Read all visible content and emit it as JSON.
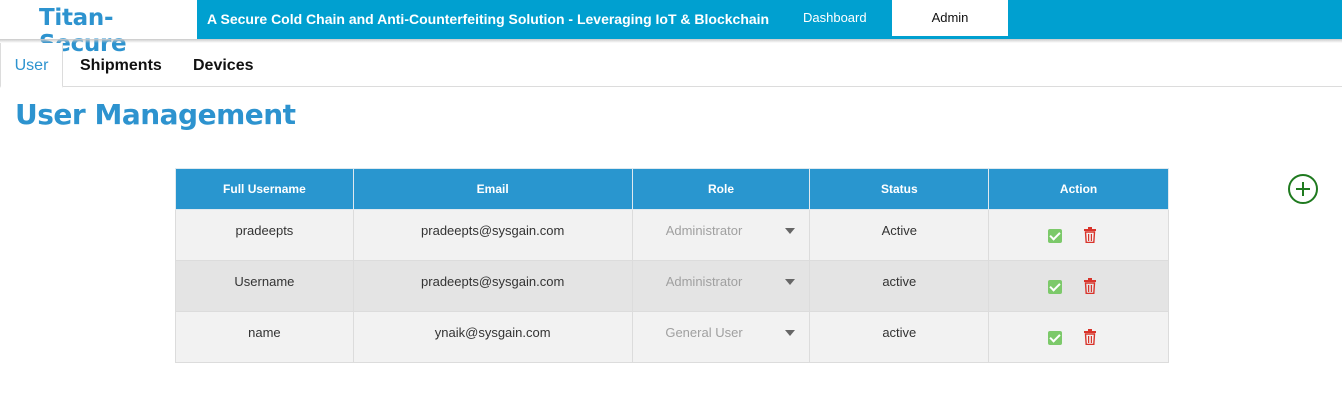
{
  "header": {
    "brand": "Titan-Secure",
    "tagline": "A Secure Cold Chain and Anti-Counterfeiting Solution - Leveraging IoT & Blockchain",
    "nav": {
      "dashboard": "Dashboard",
      "admin": "Admin"
    },
    "active_nav": "Admin"
  },
  "tabs": {
    "user": "User",
    "shipments": "Shipments",
    "devices": "Devices",
    "active": "User"
  },
  "page_title": "User Management",
  "table": {
    "headers": {
      "username": "Full Username",
      "email": "Email",
      "role": "Role",
      "status": "Status",
      "action": "Action"
    },
    "rows": [
      {
        "username": "pradeepts",
        "email": "pradeepts@sysgain.com",
        "role": "Administrator",
        "status": "Active"
      },
      {
        "username": "Username",
        "email": "pradeepts@sysgain.com",
        "role": "Administrator",
        "status": "active"
      },
      {
        "username": "name",
        "email": "ynaik@sysgain.com",
        "role": "General User",
        "status": "active"
      }
    ]
  },
  "icons": {
    "add": "add-circle-icon",
    "approve": "check-icon",
    "delete": "trash-icon",
    "role_dropdown": "caret-down-icon"
  },
  "colors": {
    "brand": "#2d93cf",
    "header_bar": "#00a0d0",
    "table_header": "#2996cf",
    "add": "#1f7a1f",
    "approve": "#7cc96a",
    "delete": "#d9342b"
  }
}
